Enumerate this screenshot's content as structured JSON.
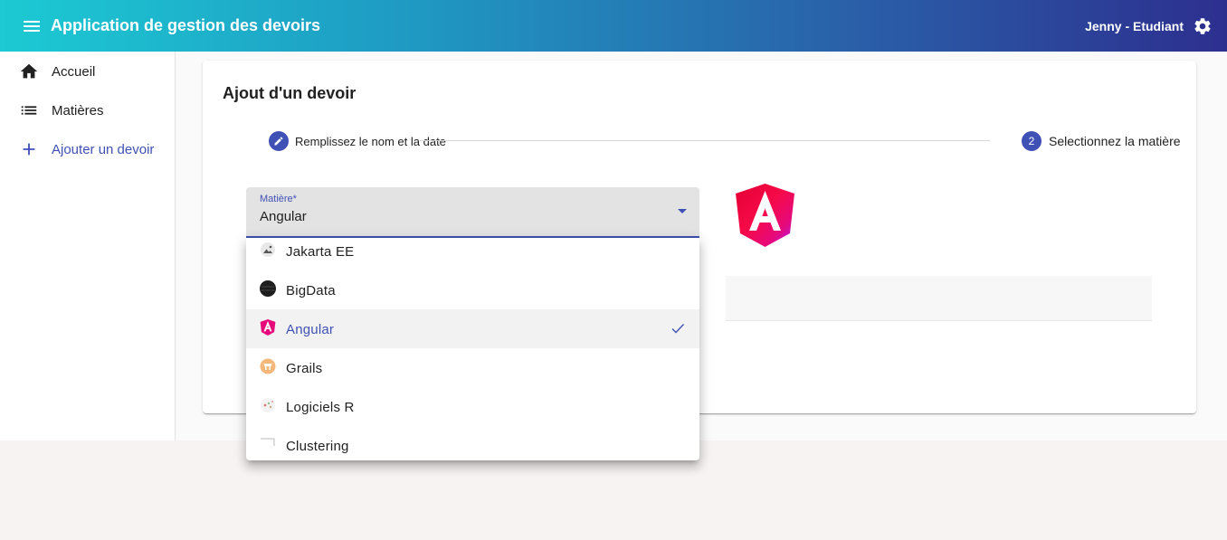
{
  "toolbar": {
    "title": "Application de gestion des devoirs",
    "user": "Jenny - Etudiant"
  },
  "sidebar": {
    "items": [
      {
        "label": "Accueil",
        "icon": "home-icon"
      },
      {
        "label": "Matières",
        "icon": "list-icon"
      },
      {
        "label": "Ajouter un devoir",
        "icon": "add-icon"
      }
    ]
  },
  "card": {
    "title": "Ajout d'un devoir"
  },
  "stepper": {
    "steps": [
      {
        "label": "Remplissez le nom et la date",
        "icon": "edit-icon"
      },
      {
        "number": "2",
        "label": "Selectionnez la matière"
      }
    ]
  },
  "select": {
    "label": "Matière*",
    "value": "Angular",
    "options": [
      {
        "label": "Jakarta EE",
        "icon": "image-icon"
      },
      {
        "label": "BigData",
        "icon": "bigdata-icon"
      },
      {
        "label": "Angular",
        "icon": "angular-icon",
        "selected": true
      },
      {
        "label": "Grails",
        "icon": "grails-icon"
      },
      {
        "label": "Logiciels R",
        "icon": "r-logo-icon"
      },
      {
        "label": "Clustering",
        "icon": "clustering-icon"
      }
    ]
  },
  "colors": {
    "accent": "#3f51b5",
    "toolbar_gradient_start": "#1ccad3",
    "toolbar_gradient_end": "#2d2f8f"
  }
}
